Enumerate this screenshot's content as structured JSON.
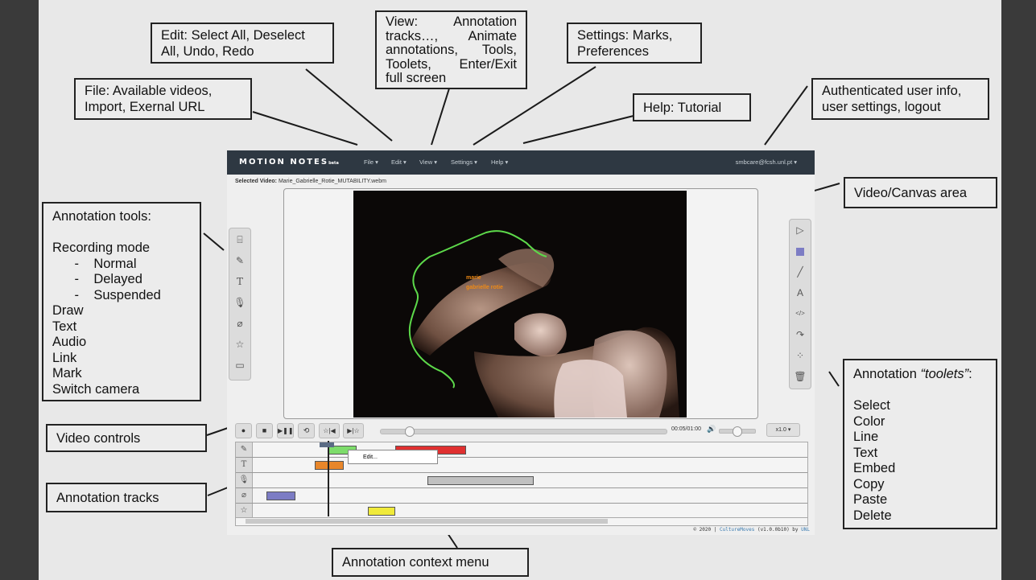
{
  "app": {
    "brand": "MOTION NOTES",
    "brand_suffix": "beta",
    "menu": [
      {
        "label": "File ▾"
      },
      {
        "label": "Edit ▾"
      },
      {
        "label": "View ▾"
      },
      {
        "label": "Settings ▾"
      },
      {
        "label": "Help ▾"
      }
    ],
    "user": "smbcare@fcsh.unl.pt ▾",
    "selected_video_label": "Selected Video:",
    "selected_video": "Marie_Gabrielle_Rotie_MUTABILITY.webm",
    "video_text_1": "marie",
    "video_text_2": "gabrielle rotie",
    "time": "00:05/01:00",
    "speed": "x1.0",
    "context_menu_item": "Edit...",
    "footer_year": "© 2020 |",
    "footer_link": "CultureMoves",
    "footer_version": "(v1.0.0b10) by",
    "footer_by": "UNL",
    "colors": {
      "navbar": "#2e3842",
      "green_bar": "#7ddc6a",
      "red_bar": "#e03030",
      "orange_bar": "#e8862a",
      "gray_bar": "#c0c0c0",
      "blue_bar": "#7c7cc4",
      "yellow_bar": "#f0ea3a",
      "canvas_stroke": "#5dd94a",
      "video_text": "#f08a14"
    }
  },
  "callouts": {
    "edit": [
      "Edit: Select All, Deselect",
      "All, Undo, Redo"
    ],
    "view": [
      [
        "View:",
        "Annotation"
      ],
      [
        "tracks…,",
        "Animate"
      ],
      [
        "annotations,",
        "Tools,"
      ],
      [
        "Toolets,",
        "Enter/Exit"
      ],
      [
        "full screen"
      ]
    ],
    "settings": [
      "Settings:  Marks,",
      "Preferences"
    ],
    "file": [
      "File: Available videos,",
      "Import, Exernal URL"
    ],
    "help": "Help:  Tutorial",
    "auth": [
      "Authenticated user info,",
      "user settings, logout"
    ],
    "canvas": "Video/Canvas area",
    "tools": [
      "Annotation tools:",
      "",
      "Recording mode",
      "      -    Normal",
      "      -    Delayed",
      "      -    Suspended",
      "Draw",
      "Text",
      "Audio",
      "Link",
      "Mark",
      "Switch camera"
    ],
    "toolets_title": "Annotation ",
    "toolets_title_em": "“toolets”",
    "toolets_title_end": ":",
    "toolets": [
      "",
      "Select",
      "Color",
      "Line",
      "Text",
      "Embed",
      "Copy",
      "Paste",
      "Delete"
    ],
    "video_controls": "Video controls",
    "tracks": "Annotation tracks",
    "context_menu": "Annotation context menu"
  }
}
